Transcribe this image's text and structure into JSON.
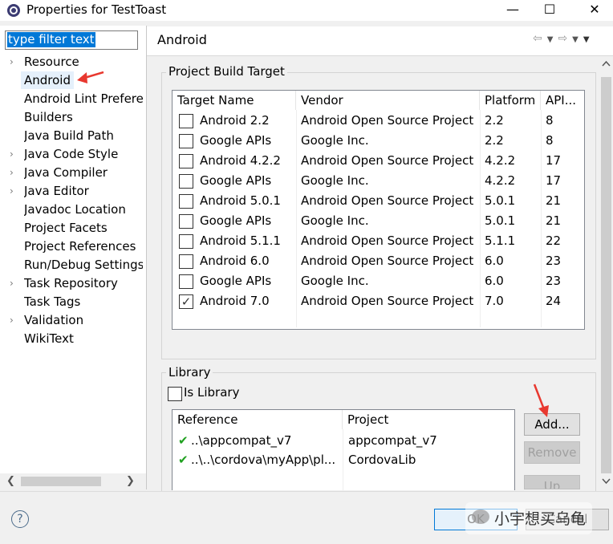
{
  "window": {
    "title": "Properties for TestToast",
    "minimize": "—",
    "maximize": "☐",
    "close": "✕"
  },
  "filter": {
    "text": "type filter text"
  },
  "tree": {
    "items": [
      {
        "label": "Resource",
        "expandable": true
      },
      {
        "label": "Android",
        "expandable": false,
        "selected": true
      },
      {
        "label": "Android Lint Preferences",
        "expandable": false
      },
      {
        "label": "Builders",
        "expandable": false
      },
      {
        "label": "Java Build Path",
        "expandable": false
      },
      {
        "label": "Java Code Style",
        "expandable": true
      },
      {
        "label": "Java Compiler",
        "expandable": true
      },
      {
        "label": "Java Editor",
        "expandable": true
      },
      {
        "label": "Javadoc Location",
        "expandable": false
      },
      {
        "label": "Project Facets",
        "expandable": false
      },
      {
        "label": "Project References",
        "expandable": false
      },
      {
        "label": "Run/Debug Settings",
        "expandable": false
      },
      {
        "label": "Task Repository",
        "expandable": true
      },
      {
        "label": "Task Tags",
        "expandable": false
      },
      {
        "label": "Validation",
        "expandable": true
      },
      {
        "label": "WikiText",
        "expandable": false
      }
    ]
  },
  "page": {
    "title": "Android"
  },
  "build_target": {
    "group_label": "Project Build Target",
    "columns": [
      "Target Name",
      "Vendor",
      "Platform",
      "API..."
    ],
    "rows": [
      {
        "name": "Android 2.2",
        "vendor": "Android Open Source Project",
        "platform": "2.2",
        "api": "8",
        "checked": false
      },
      {
        "name": "Google APIs",
        "vendor": "Google Inc.",
        "platform": "2.2",
        "api": "8",
        "checked": false
      },
      {
        "name": "Android 4.2.2",
        "vendor": "Android Open Source Project",
        "platform": "4.2.2",
        "api": "17",
        "checked": false
      },
      {
        "name": "Google APIs",
        "vendor": "Google Inc.",
        "platform": "4.2.2",
        "api": "17",
        "checked": false
      },
      {
        "name": "Android 5.0.1",
        "vendor": "Android Open Source Project",
        "platform": "5.0.1",
        "api": "21",
        "checked": false
      },
      {
        "name": "Google APIs",
        "vendor": "Google Inc.",
        "platform": "5.0.1",
        "api": "21",
        "checked": false
      },
      {
        "name": "Android 5.1.1",
        "vendor": "Android Open Source Project",
        "platform": "5.1.1",
        "api": "22",
        "checked": false
      },
      {
        "name": "Android 6.0",
        "vendor": "Android Open Source Project",
        "platform": "6.0",
        "api": "23",
        "checked": false
      },
      {
        "name": "Google APIs",
        "vendor": "Google Inc.",
        "platform": "6.0",
        "api": "23",
        "checked": false
      },
      {
        "name": "Android 7.0",
        "vendor": "Android Open Source Project",
        "platform": "7.0",
        "api": "24",
        "checked": true
      }
    ]
  },
  "library": {
    "group_label": "Library",
    "is_library_label": "Is Library",
    "columns": [
      "Reference",
      "Project"
    ],
    "rows": [
      {
        "reference": "..\\appcompat_v7",
        "project": "appcompat_v7"
      },
      {
        "reference": "..\\..\\cordova\\myApp\\pl...",
        "project": "CordovaLib"
      }
    ],
    "buttons": {
      "add": "Add...",
      "remove": "Remove",
      "up": "Up"
    }
  },
  "footer": {
    "help": "?",
    "ok": "OK",
    "cancel": "Cancel",
    "watermark": "小宇想买乌龟"
  },
  "colors": {
    "selection": "#0078d7",
    "annotation_arrow": "#e8382f",
    "check_green": "#1fa01f"
  }
}
